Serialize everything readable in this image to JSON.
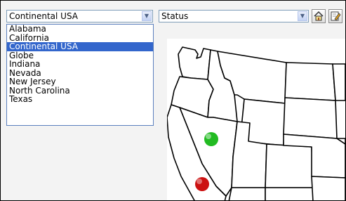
{
  "region_select": {
    "value": "Continental USA",
    "icon": "chevron-down-icon"
  },
  "status_select": {
    "value": "Status",
    "icon": "chevron-down-icon"
  },
  "toolbar": {
    "home_icon": "home-icon",
    "edit_icon": "edit-icon"
  },
  "region_options": [
    {
      "label": "Alabama"
    },
    {
      "label": "California"
    },
    {
      "label": "Continental USA",
      "selected": true
    },
    {
      "label": "Globe"
    },
    {
      "label": "Indiana"
    },
    {
      "label": "Nevada"
    },
    {
      "label": "New Jersey"
    },
    {
      "label": "North Carolina"
    },
    {
      "label": "Texas"
    }
  ],
  "map": {
    "markers": [
      {
        "status": "green",
        "color": "#22bb22"
      },
      {
        "status": "red",
        "color": "#cc1111"
      }
    ],
    "colors": {
      "selection": "#3366cc",
      "border": "#7f9db9"
    }
  }
}
